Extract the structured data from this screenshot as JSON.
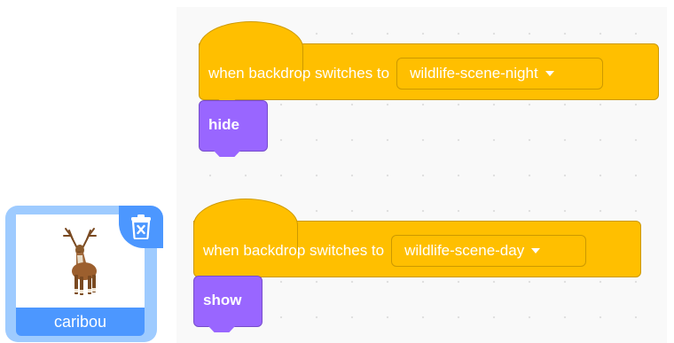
{
  "scripts": [
    {
      "hat_label": "when backdrop switches to",
      "backdrop_value": "wildlife-scene-night",
      "action_label": "hide"
    },
    {
      "hat_label": "when backdrop switches to",
      "backdrop_value": "wildlife-scene-day",
      "action_label": "show"
    }
  ],
  "sprite": {
    "name": "caribou",
    "delete_icon": "trash-icon"
  },
  "colors": {
    "event_block": "#ffbf00",
    "looks_block": "#9966ff",
    "sprite_selected": "#4c97ff"
  }
}
